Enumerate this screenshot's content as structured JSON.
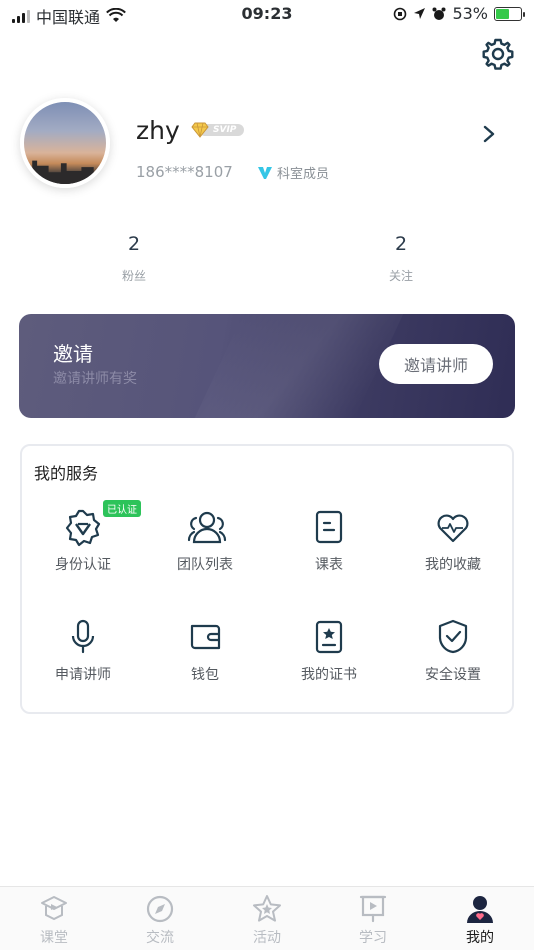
{
  "status_bar": {
    "carrier": "中国联通",
    "time": "09:23",
    "battery": "53%",
    "battery_level": 0.53
  },
  "profile": {
    "username": "zhy",
    "vip_badge": "SVIP",
    "phone": "186****8107",
    "member_label": "科室成员"
  },
  "stats": {
    "fans": {
      "value": "2",
      "label": "粉丝"
    },
    "following": {
      "value": "2",
      "label": "关注"
    }
  },
  "invite": {
    "title": "邀请",
    "subtitle": "邀请讲师有奖",
    "button_label": "邀请讲师"
  },
  "services": {
    "title": "我的服务",
    "items": [
      {
        "label": "身份认证",
        "icon": "identity-shield-icon",
        "badge": "已认证"
      },
      {
        "label": "团队列表",
        "icon": "team-icon"
      },
      {
        "label": "课表",
        "icon": "schedule-icon"
      },
      {
        "label": "我的收藏",
        "icon": "heart-icon"
      },
      {
        "label": "申请讲师",
        "icon": "microphone-icon"
      },
      {
        "label": "钱包",
        "icon": "wallet-icon"
      },
      {
        "label": "我的证书",
        "icon": "certificate-icon"
      },
      {
        "label": "安全设置",
        "icon": "security-shield-icon"
      }
    ]
  },
  "tabbar": {
    "items": [
      {
        "label": "课堂",
        "icon": "classroom-icon"
      },
      {
        "label": "交流",
        "icon": "compass-icon"
      },
      {
        "label": "活动",
        "icon": "star-icon"
      },
      {
        "label": "学习",
        "icon": "presentation-icon"
      },
      {
        "label": "我的",
        "icon": "profile-icon",
        "active": true
      }
    ]
  },
  "colors": {
    "accent_dark": "#1f3b4d",
    "badge_green": "#2dc35a",
    "banner": "#4a4870",
    "vip_cyan": "#35c6e6"
  }
}
